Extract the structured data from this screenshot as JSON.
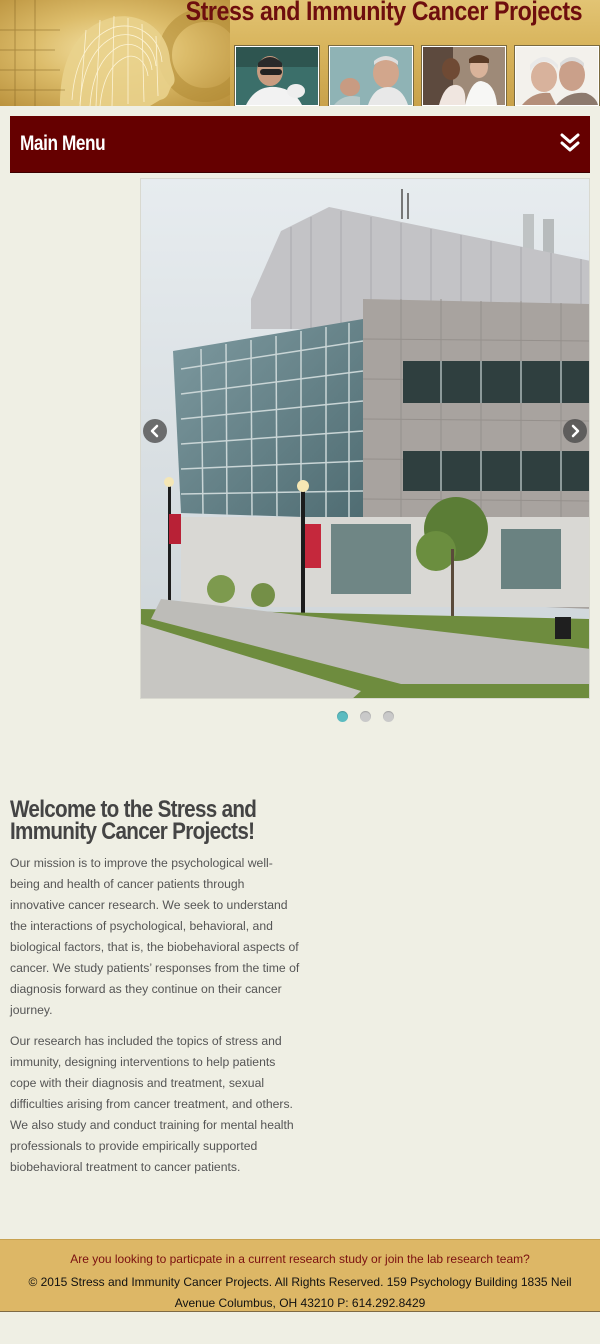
{
  "header": {
    "site_title": "Stress and Immunity Cancer Projects"
  },
  "menu": {
    "label": "Main Menu",
    "toggle_icon": "double-chevron-down-icon"
  },
  "slider": {
    "slide_image": "research building photo",
    "prev_icon": "chevron-left-icon",
    "next_icon": "chevron-right-icon",
    "active_dot": 0,
    "dot_count": 3
  },
  "content": {
    "heading": "Welcome to the Stress and Immunity Cancer Projects!",
    "paragraph_1": "Our mission is to improve the psychological well-being and health of cancer patients through innovative cancer research. We seek to understand the interactions of psychological, behavioral, and biological factors, that is, the biobehavioral aspects of cancer. We study patients’ responses from the time of diagnosis forward as they continue on their cancer journey.",
    "paragraph_2": "Our research has included the topics of stress and immunity, designing interventions to help patients cope with their diagnosis and treatment, sexual difficulties arising from cancer treatment, and others. We also study and conduct training for mental health professionals to provide empirically supported biobehavioral treatment to cancer patients."
  },
  "footer": {
    "cta": "Are you looking to particpate in a current research study or join the lab research team?",
    "copyright": "© 2015 Stress and Immunity Cancer Projects. All Rights Reserved. 159 Psychology Building 1835 Neil Avenue Columbus, OH 43210 P: 614.292.8429"
  },
  "colors": {
    "brand_maroon": "#650000",
    "header_gold": "#d8b45c",
    "footer_gold": "#ddb766",
    "dot_active": "#5bbbc0",
    "dot_inactive": "#c9c9c9",
    "page_background": "#efefe4"
  }
}
